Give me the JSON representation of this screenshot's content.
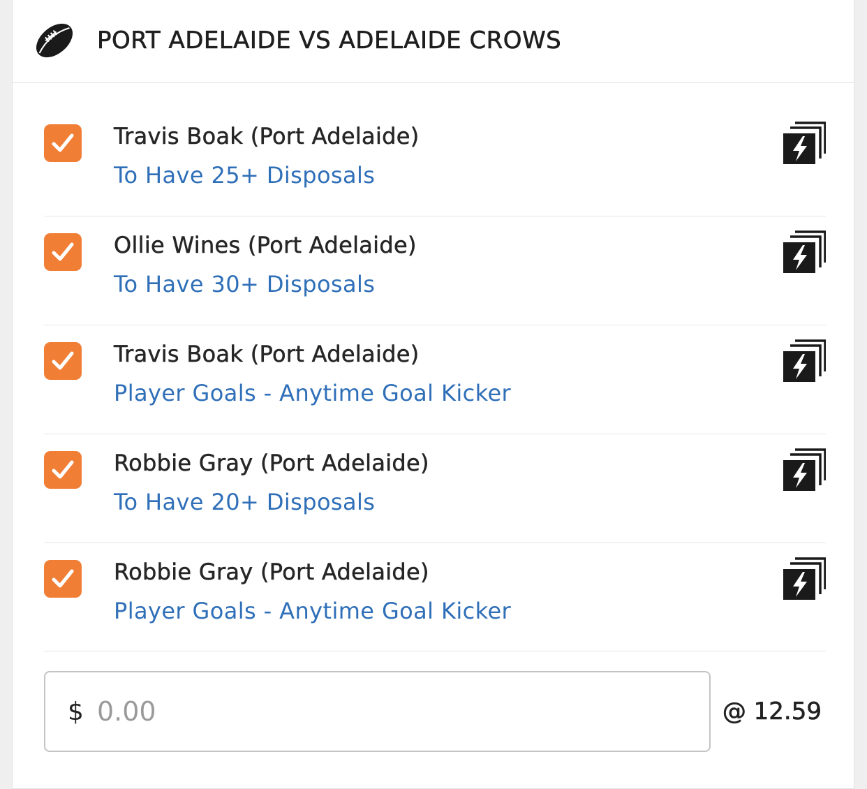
{
  "header": {
    "title": "PORT ADELAIDE VS ADELAIDE CROWS",
    "icon": "football-icon"
  },
  "legs": [
    {
      "player": "Travis Boak (Port Adelaide)",
      "market": "To Have 25+ Disposals",
      "checked": true
    },
    {
      "player": "Ollie Wines (Port Adelaide)",
      "market": "To Have 30+ Disposals",
      "checked": true
    },
    {
      "player": "Travis Boak (Port Adelaide)",
      "market": "Player Goals - Anytime Goal Kicker",
      "checked": true
    },
    {
      "player": "Robbie Gray (Port Adelaide)",
      "market": "To Have 20+ Disposals",
      "checked": true
    },
    {
      "player": "Robbie Gray (Port Adelaide)",
      "market": "Player Goals - Anytime Goal Kicker",
      "checked": true
    }
  ],
  "leg_icon": "same-game-multi-icon",
  "stake": {
    "currency": "$",
    "placeholder": "0.00",
    "value": ""
  },
  "odds": "@ 12.59",
  "colors": {
    "accent": "#f17e35",
    "link": "#2f6fb8",
    "text": "#262626",
    "background": "#efefef"
  }
}
